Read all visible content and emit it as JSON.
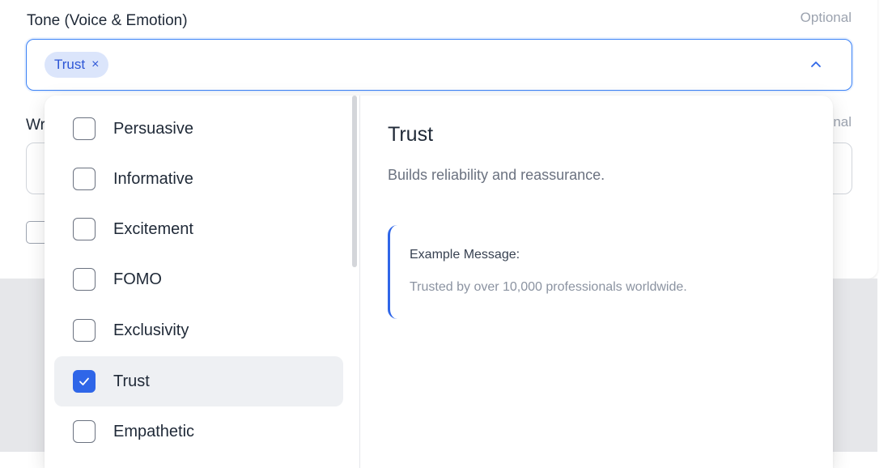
{
  "tone_field": {
    "label": "Tone (Voice & Emotion)",
    "optional": "Optional",
    "selected_chips": [
      {
        "label": "Trust"
      }
    ],
    "chip_remove_glyph": "×",
    "expanded": true
  },
  "writing_field": {
    "label_fragment": "Wr",
    "optional_fragment": "nal"
  },
  "dropdown": {
    "options": [
      {
        "label": "Persuasive",
        "checked": false
      },
      {
        "label": "Informative",
        "checked": false
      },
      {
        "label": "Excitement",
        "checked": false
      },
      {
        "label": "FOMO",
        "checked": false
      },
      {
        "label": "Exclusivity",
        "checked": false
      },
      {
        "label": "Trust",
        "checked": true
      },
      {
        "label": "Empathetic",
        "checked": false
      }
    ],
    "detail": {
      "title": "Trust",
      "description": "Builds reliability and reassurance.",
      "example_label": "Example Message:",
      "example_text": "Trusted by over 10,000 professionals worldwide."
    }
  },
  "icons": {
    "chevron": "chevron-up-icon",
    "check": "check-icon",
    "close": "close-icon"
  },
  "colors": {
    "accent": "#2f66e8",
    "chip_bg": "#dbe5fb",
    "chip_text": "#2d56d6",
    "focus_border": "#3b82f6",
    "muted_text": "#9ca3af",
    "selected_row": "#eef0f3"
  }
}
